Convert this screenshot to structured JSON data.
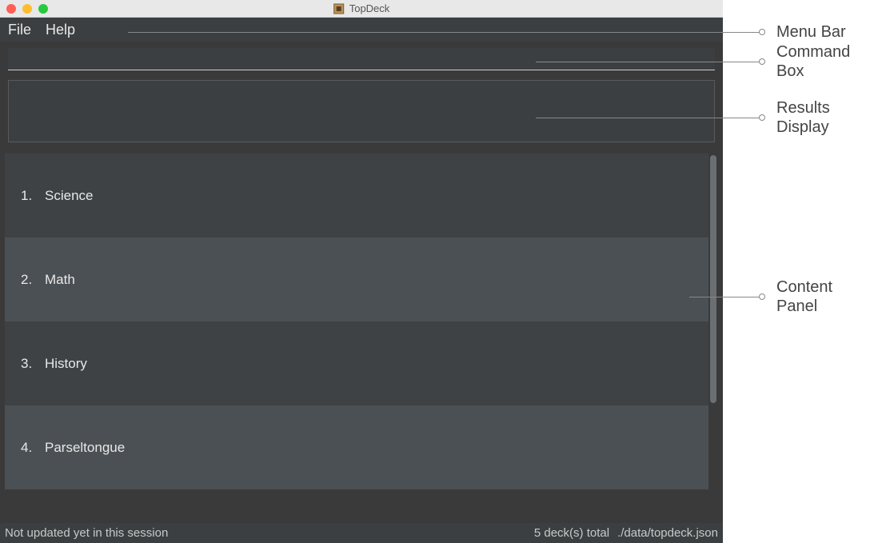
{
  "window": {
    "title": "TopDeck"
  },
  "menubar": {
    "items": [
      "File",
      "Help"
    ]
  },
  "command_box": {
    "value": "",
    "placeholder": ""
  },
  "content": {
    "decks": [
      {
        "index": "1.",
        "name": "Science"
      },
      {
        "index": "2.",
        "name": "Math"
      },
      {
        "index": "3.",
        "name": "History"
      },
      {
        "index": "4.",
        "name": "Parseltongue"
      }
    ]
  },
  "status": {
    "left": "Not updated yet in this session",
    "deck_count": "5 deck(s) total",
    "path": "./data/topdeck.json"
  },
  "annotations": {
    "menu_bar": "Menu Bar",
    "command_box_l1": "Command",
    "command_box_l2": "Box",
    "results_l1": "Results",
    "results_l2": "Display",
    "content_l1": "Content",
    "content_l2": "Panel"
  }
}
